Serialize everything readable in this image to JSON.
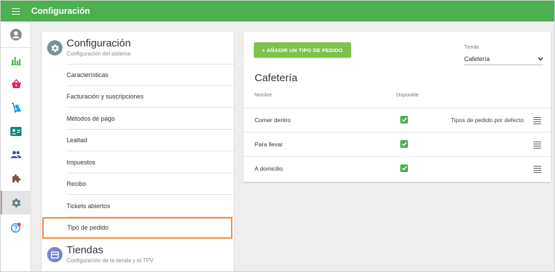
{
  "app": {
    "title": "Configuración"
  },
  "colors": {
    "topbar": "#4caf50",
    "accent_button": "#7cc24c",
    "highlight_outline": "#f08a36",
    "checkbox": "#4caf50"
  },
  "sidenav": {
    "items": [
      {
        "icon": "account-circle-icon"
      },
      {
        "icon": "bar-chart-icon"
      },
      {
        "icon": "basket-icon"
      },
      {
        "icon": "hand-truck-icon"
      },
      {
        "icon": "id-card-icon"
      },
      {
        "icon": "people-icon"
      },
      {
        "icon": "puzzle-icon"
      },
      {
        "icon": "settings-icon",
        "active": true
      },
      {
        "icon": "help-icon",
        "badge": true
      }
    ]
  },
  "settings": {
    "title": "Configuración",
    "subtitle": "Configuración del sistema",
    "items": [
      {
        "label": "Características"
      },
      {
        "label": "Facturación y suscripciones"
      },
      {
        "label": "Métodos de pago"
      },
      {
        "label": "Lealtad"
      },
      {
        "label": "Impuestos"
      },
      {
        "label": "Recibo"
      },
      {
        "label": "Tickets abiertos"
      },
      {
        "label": "Tipo de pedido",
        "selected": true
      }
    ]
  },
  "stores_section": {
    "title": "Tiendas",
    "subtitle": "Configuración de la tienda y el TPV"
  },
  "order_types": {
    "add_button_label": "+ AÑADIR UN TIPO DE PEDIDO",
    "store_label": "Tienda",
    "store_value": "Cafetería",
    "heading": "Cafetería",
    "columns": {
      "name": "Nombre",
      "available": "Disponible"
    },
    "rows": [
      {
        "name": "Comer dentro",
        "available": true,
        "note": "Tipos de pedido por defecto"
      },
      {
        "name": "Para llevar",
        "available": true,
        "note": ""
      },
      {
        "name": "A domicilio",
        "available": true,
        "note": ""
      }
    ]
  }
}
